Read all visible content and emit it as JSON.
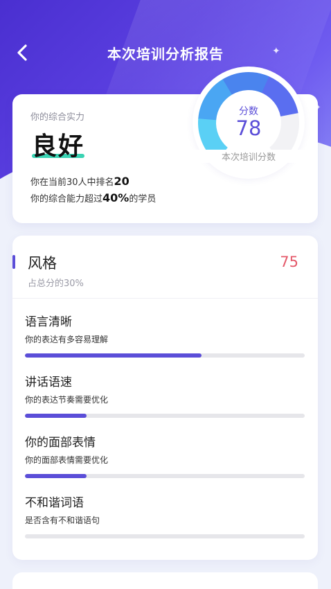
{
  "header": {
    "title": "本次培训分析报告"
  },
  "summary": {
    "label": "你的综合实力",
    "grade": "良好",
    "rank_prefix": "你在当前30人中排名",
    "rank_value": "20",
    "exceed_prefix": "你的综合能力超过",
    "exceed_value": "40%",
    "exceed_suffix": "的学员"
  },
  "gauge": {
    "label": "分数",
    "score": "78",
    "caption": "本次培训分数",
    "score_fraction": 0.78,
    "colors": {
      "seg1": "#5ad0f5",
      "seg2": "#4aa6f3",
      "seg3": "#4a84ee",
      "seg4": "#5a6ef0",
      "rest": "#f2f2f5",
      "score_text": "#5b4ed8"
    }
  },
  "style_section": {
    "title": "风格",
    "score": "75",
    "subtitle": "占总分的30%",
    "metrics": [
      {
        "title": "语言清晰",
        "desc": "你的表达有多容易理解",
        "progress": 0.63
      },
      {
        "title": "讲话语速",
        "desc": "你的表达节奏需要优化",
        "progress": 0.22
      },
      {
        "title": "你的面部表情",
        "desc": "你的面部表情需要优化",
        "progress": 0.22
      },
      {
        "title": "不和谐词语",
        "desc": "是否含有不和谐语句",
        "progress": 0
      }
    ]
  },
  "colors": {
    "accent": "#5b4ed8",
    "score_red": "#e4596a",
    "grade_underline": "#3ad3b3"
  }
}
